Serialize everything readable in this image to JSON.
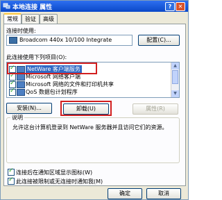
{
  "window": {
    "title": "本地连接 属性",
    "help_label": "?",
    "close_label": "✕"
  },
  "tabs": [
    {
      "label": "常规"
    },
    {
      "label": "验证"
    },
    {
      "label": "高级"
    }
  ],
  "connect_using": {
    "label": "连接时使用:",
    "adapter": "Broadcom 440x 10/100 Integrate",
    "configure_label": "配置(C)..."
  },
  "components": {
    "label": "此连接使用下列项目(O):",
    "items": [
      {
        "text": "NetWare 客户端服务",
        "checked": true,
        "selected": true
      },
      {
        "text": "Microsoft 网络客户端",
        "checked": true,
        "selected": false
      },
      {
        "text": "Microsoft 网络的文件和打印机共享",
        "checked": true,
        "selected": false
      },
      {
        "text": "QoS 数据包计划程序",
        "checked": true,
        "selected": false
      }
    ]
  },
  "buttons": {
    "install": "安装(N)...",
    "uninstall": "卸载(U)",
    "properties": "属性(R)"
  },
  "description": {
    "title": "说明",
    "text": "允许这台计算机登录到 NetWare 服务器并且访问它们的资源。"
  },
  "options": {
    "show_icon": "连接后在通知区域显示图标(W)",
    "notify_limited": "此连接被限制或无连接时通知我(M)"
  },
  "footer": {
    "ok": "确定",
    "cancel": "取消"
  },
  "colors": {
    "highlight_red": "#d21f1f",
    "selection_blue": "#316ac5"
  }
}
